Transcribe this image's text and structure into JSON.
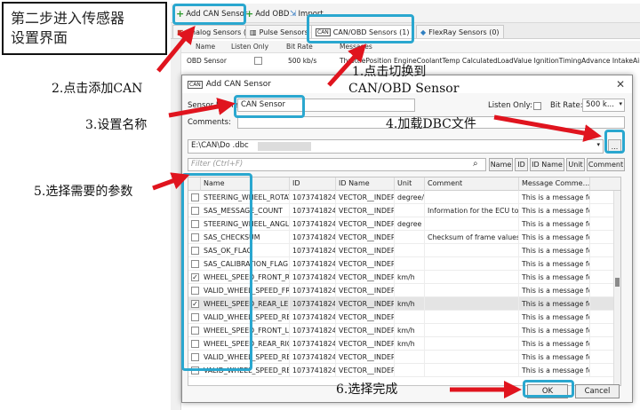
{
  "intro_note": {
    "line1": "第二步进入传感器",
    "line2": "设置界面"
  },
  "toolbar": {
    "add_can": "Add CAN Sensor",
    "add_obd": "Add OBD",
    "import": "Import"
  },
  "tabs": [
    {
      "label": "Analog Sensors (0)"
    },
    {
      "label": "Pulse Sensors (0)"
    },
    {
      "label": "CAN/OBD Sensors (1)"
    },
    {
      "label": "FlexRay Sensors (0)"
    }
  ],
  "bg_table": {
    "headers": [
      "Name",
      "Listen Only",
      "Bit Rate",
      "Messages"
    ],
    "row": {
      "name": "OBD Sensor",
      "bitrate": "500 kb/s",
      "messages": "ThrottlePosition  EngineCoolantTemp  CalculatedLoadValue  IgnitionTimingAdvance  IntakeAir"
    }
  },
  "dialog": {
    "title": "Add CAN Sensor",
    "sensor_name_label": "Sensor Name",
    "sensor_name_value": "CAN Sensor",
    "listen_only_label": "Listen Only:",
    "bit_rate_label": "Bit Rate:",
    "bit_rate_value": "500 k...",
    "comments_label": "Comments:",
    "dbc_path": "E:\\CAN\\Do                        .dbc",
    "browse_label": "...",
    "filter_placeholder": "Filter (Ctrl+F)",
    "filter_buttons": [
      "Name",
      "ID",
      "ID Name",
      "Unit",
      "Comment"
    ],
    "columns": [
      "Name",
      "ID",
      "ID Name",
      "Unit",
      "Comment",
      "Message Comme..."
    ],
    "rows": [
      {
        "checked": false,
        "name": "STEERING_WHEEL_ROTAT",
        "id": "1073741824",
        "idname": "VECTOR__INDEP",
        "unit": "degree/",
        "comment": "",
        "msg": "This is a message fo"
      },
      {
        "checked": false,
        "name": "SAS_MESSAGE_COUNT",
        "id": "1073741824",
        "idname": "VECTOR__INDEP",
        "unit": "",
        "comment": "Information for the ECU to",
        "msg": "This is a message fo"
      },
      {
        "checked": false,
        "name": "STEERING_WHEEL_ANGLE",
        "id": "1073741824",
        "idname": "VECTOR__INDEP",
        "unit": "degree",
        "comment": "",
        "msg": "This is a message fo"
      },
      {
        "checked": false,
        "name": "SAS_CHECKSUM",
        "id": "1073741824",
        "idname": "VECTOR__INDEP",
        "unit": "",
        "comment": "Checksum of frame values;",
        "msg": "This is a message fo"
      },
      {
        "checked": false,
        "name": "SAS_OK_FLAG",
        "id": "1073741824",
        "idname": "VECTOR__INDEP",
        "unit": "",
        "comment": "",
        "msg": "This is a message fo"
      },
      {
        "checked": false,
        "name": "SAS_CALIBRATION_FLAG",
        "id": "1073741824",
        "idname": "VECTOR__INDEP",
        "unit": "",
        "comment": "",
        "msg": "This is a message fo"
      },
      {
        "checked": true,
        "name": "WHEEL_SPEED_FRONT_RI",
        "id": "1073741824",
        "idname": "VECTOR__INDEP",
        "unit": "km/h",
        "comment": "",
        "msg": "This is a message fo"
      },
      {
        "checked": false,
        "name": "VALID_WHEEL_SPEED_FR",
        "id": "1073741824",
        "idname": "VECTOR__INDEP",
        "unit": "",
        "comment": "",
        "msg": "This is a message fo"
      },
      {
        "checked": true,
        "name": "WHEEL_SPEED_REAR_LEF",
        "id": "1073741824",
        "idname": "VECTOR__INDEP",
        "unit": "km/h",
        "comment": "",
        "msg": "This is a message fo"
      },
      {
        "checked": false,
        "name": "VALID_WHEEL_SPEED_RE",
        "id": "1073741824",
        "idname": "VECTOR__INDEP",
        "unit": "",
        "comment": "",
        "msg": "This is a message fo"
      },
      {
        "checked": false,
        "name": "WHEEL_SPEED_FRONT_LE",
        "id": "1073741824",
        "idname": "VECTOR__INDEP",
        "unit": "km/h",
        "comment": "",
        "msg": "This is a message fo"
      },
      {
        "checked": false,
        "name": "WHEEL_SPEED_REAR_RIG",
        "id": "1073741824",
        "idname": "VECTOR__INDEP",
        "unit": "km/h",
        "comment": "",
        "msg": "This is a message fo"
      },
      {
        "checked": false,
        "name": "VALID_WHEEL_SPEED_RE",
        "id": "1073741824",
        "idname": "VECTOR__INDEP",
        "unit": "",
        "comment": "",
        "msg": "This is a message fo"
      },
      {
        "checked": false,
        "name": "VALID_WHEEL_SPEED_RE",
        "id": "1073741824",
        "idname": "VECTOR__INDEP",
        "unit": "",
        "comment": "",
        "msg": "This is a message fo"
      }
    ],
    "ok_label": "OK",
    "cancel_label": "Cancel"
  },
  "annotations": {
    "step1_line1": "1.点击切换到",
    "step1_line2": "CAN/OBD Sensor",
    "step2": "2.点击添加CAN",
    "step3": "3.设置名称",
    "step4": "4.加载DBC文件",
    "step5": "5.选择需要的参数",
    "step6": "6.选择完成"
  },
  "colors": {
    "highlight": "#2aa7cf",
    "arrow": "#e0141e"
  }
}
